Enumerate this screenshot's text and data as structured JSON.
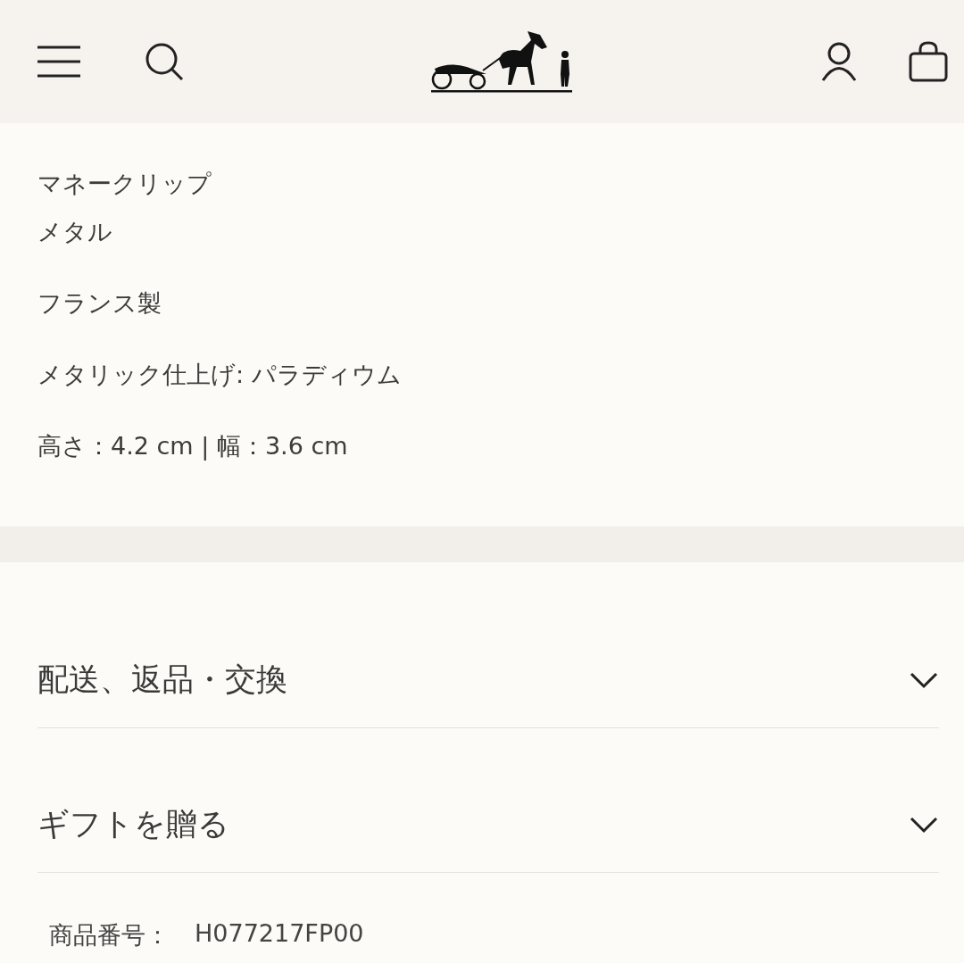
{
  "details": [
    "マネークリップ",
    "メタル",
    "フランス製",
    "メタリック仕上げ: パラディウム",
    "高さ：4.2 cm | 幅：3.6 cm"
  ],
  "accordions": [
    {
      "title": "配送、返品・交換",
      "expanded": false
    },
    {
      "title": "ギフトを贈る",
      "expanded": false
    }
  ],
  "product_number": {
    "label": "商品番号：",
    "value": "H077217FP00"
  }
}
